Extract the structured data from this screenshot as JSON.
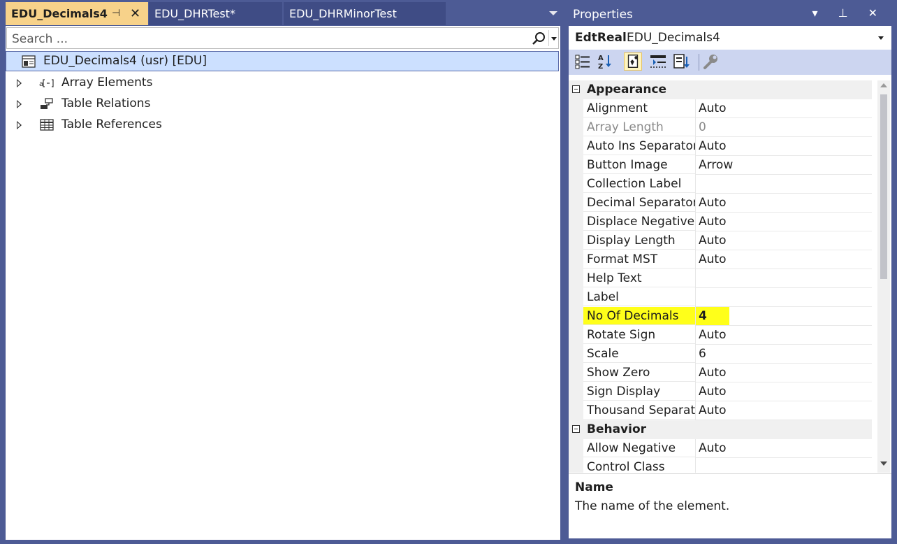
{
  "editor": {
    "tabs": [
      {
        "label": "EDU_Decimals4",
        "active": true
      },
      {
        "label": "EDU_DHRTest*",
        "active": false
      },
      {
        "label": "EDU_DHRMinorTest",
        "active": false
      }
    ],
    "pin_glyph": "⊣",
    "close_glyph": "✕"
  },
  "search": {
    "placeholder": "Search ...",
    "value": ""
  },
  "tree": {
    "root": "EDU_Decimals4 (usr) [EDU]",
    "items": [
      {
        "label": "Array Elements",
        "icon": "array-icon"
      },
      {
        "label": "Table Relations",
        "icon": "relations-icon"
      },
      {
        "label": "Table References",
        "icon": "table-icon"
      }
    ]
  },
  "properties": {
    "title": "Properties",
    "title_buttons": "▾ ⊥ ✕",
    "object_type": "EdtReal",
    "object_name": "EDU_Decimals4",
    "categories": [
      {
        "name": "Appearance",
        "rows": [
          {
            "name": "Alignment",
            "value": "Auto"
          },
          {
            "name": "Array Length",
            "value": "0",
            "disabled": true
          },
          {
            "name": "Auto Ins Separator",
            "value": "Auto"
          },
          {
            "name": "Button Image",
            "value": "Arrow"
          },
          {
            "name": "Collection Label",
            "value": ""
          },
          {
            "name": "Decimal Separator",
            "value": "Auto"
          },
          {
            "name": "Displace Negative",
            "value": "Auto"
          },
          {
            "name": "Display Length",
            "value": "Auto"
          },
          {
            "name": "Format MST",
            "value": "Auto"
          },
          {
            "name": "Help Text",
            "value": ""
          },
          {
            "name": "Label",
            "value": ""
          },
          {
            "name": "No Of Decimals",
            "value": "4",
            "highlight": true
          },
          {
            "name": "Rotate Sign",
            "value": "Auto"
          },
          {
            "name": "Scale",
            "value": "6"
          },
          {
            "name": "Show Zero",
            "value": "Auto"
          },
          {
            "name": "Sign Display",
            "value": "Auto"
          },
          {
            "name": "Thousand Separato",
            "value": "Auto"
          }
        ]
      },
      {
        "name": "Behavior",
        "rows": [
          {
            "name": "Allow Negative",
            "value": "Auto"
          },
          {
            "name": "Control Class",
            "value": ""
          }
        ]
      }
    ],
    "description": {
      "title": "Name",
      "text": "The name of the element."
    }
  },
  "colors": {
    "highlight": "#ffff1a",
    "active_tab": "#f7d28a",
    "frame": "#4d5b95",
    "selection": "#cce0ff"
  }
}
